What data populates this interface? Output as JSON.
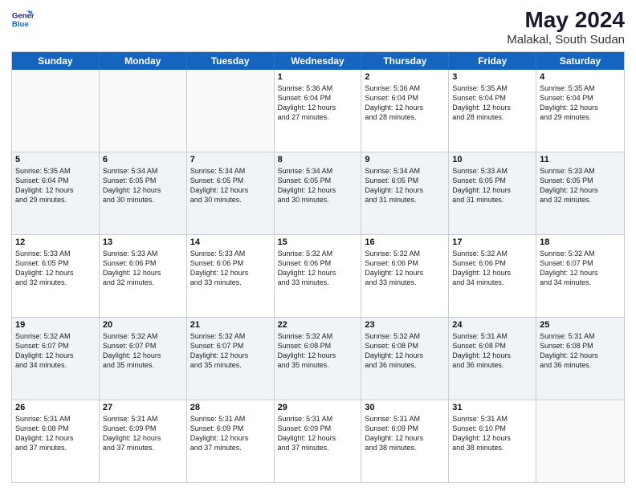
{
  "logo": {
    "line1": "General",
    "line2": "Blue"
  },
  "title": "May 2024",
  "subtitle": "Malakal, South Sudan",
  "days": [
    "Sunday",
    "Monday",
    "Tuesday",
    "Wednesday",
    "Thursday",
    "Friday",
    "Saturday"
  ],
  "weeks": [
    [
      {
        "day": "",
        "text": ""
      },
      {
        "day": "",
        "text": ""
      },
      {
        "day": "",
        "text": ""
      },
      {
        "day": "1",
        "text": "Sunrise: 5:36 AM\nSunset: 6:04 PM\nDaylight: 12 hours\nand 27 minutes."
      },
      {
        "day": "2",
        "text": "Sunrise: 5:36 AM\nSunset: 6:04 PM\nDaylight: 12 hours\nand 28 minutes."
      },
      {
        "day": "3",
        "text": "Sunrise: 5:35 AM\nSunset: 6:04 PM\nDaylight: 12 hours\nand 28 minutes."
      },
      {
        "day": "4",
        "text": "Sunrise: 5:35 AM\nSunset: 6:04 PM\nDaylight: 12 hours\nand 29 minutes."
      }
    ],
    [
      {
        "day": "5",
        "text": "Sunrise: 5:35 AM\nSunset: 6:04 PM\nDaylight: 12 hours\nand 29 minutes."
      },
      {
        "day": "6",
        "text": "Sunrise: 5:34 AM\nSunset: 6:05 PM\nDaylight: 12 hours\nand 30 minutes."
      },
      {
        "day": "7",
        "text": "Sunrise: 5:34 AM\nSunset: 6:05 PM\nDaylight: 12 hours\nand 30 minutes."
      },
      {
        "day": "8",
        "text": "Sunrise: 5:34 AM\nSunset: 6:05 PM\nDaylight: 12 hours\nand 30 minutes."
      },
      {
        "day": "9",
        "text": "Sunrise: 5:34 AM\nSunset: 6:05 PM\nDaylight: 12 hours\nand 31 minutes."
      },
      {
        "day": "10",
        "text": "Sunrise: 5:33 AM\nSunset: 6:05 PM\nDaylight: 12 hours\nand 31 minutes."
      },
      {
        "day": "11",
        "text": "Sunrise: 5:33 AM\nSunset: 6:05 PM\nDaylight: 12 hours\nand 32 minutes."
      }
    ],
    [
      {
        "day": "12",
        "text": "Sunrise: 5:33 AM\nSunset: 6:05 PM\nDaylight: 12 hours\nand 32 minutes."
      },
      {
        "day": "13",
        "text": "Sunrise: 5:33 AM\nSunset: 6:06 PM\nDaylight: 12 hours\nand 32 minutes."
      },
      {
        "day": "14",
        "text": "Sunrise: 5:33 AM\nSunset: 6:06 PM\nDaylight: 12 hours\nand 33 minutes."
      },
      {
        "day": "15",
        "text": "Sunrise: 5:32 AM\nSunset: 6:06 PM\nDaylight: 12 hours\nand 33 minutes."
      },
      {
        "day": "16",
        "text": "Sunrise: 5:32 AM\nSunset: 6:06 PM\nDaylight: 12 hours\nand 33 minutes."
      },
      {
        "day": "17",
        "text": "Sunrise: 5:32 AM\nSunset: 6:06 PM\nDaylight: 12 hours\nand 34 minutes."
      },
      {
        "day": "18",
        "text": "Sunrise: 5:32 AM\nSunset: 6:07 PM\nDaylight: 12 hours\nand 34 minutes."
      }
    ],
    [
      {
        "day": "19",
        "text": "Sunrise: 5:32 AM\nSunset: 6:07 PM\nDaylight: 12 hours\nand 34 minutes."
      },
      {
        "day": "20",
        "text": "Sunrise: 5:32 AM\nSunset: 6:07 PM\nDaylight: 12 hours\nand 35 minutes."
      },
      {
        "day": "21",
        "text": "Sunrise: 5:32 AM\nSunset: 6:07 PM\nDaylight: 12 hours\nand 35 minutes."
      },
      {
        "day": "22",
        "text": "Sunrise: 5:32 AM\nSunset: 6:08 PM\nDaylight: 12 hours\nand 35 minutes."
      },
      {
        "day": "23",
        "text": "Sunrise: 5:32 AM\nSunset: 6:08 PM\nDaylight: 12 hours\nand 36 minutes."
      },
      {
        "day": "24",
        "text": "Sunrise: 5:31 AM\nSunset: 6:08 PM\nDaylight: 12 hours\nand 36 minutes."
      },
      {
        "day": "25",
        "text": "Sunrise: 5:31 AM\nSunset: 6:08 PM\nDaylight: 12 hours\nand 36 minutes."
      }
    ],
    [
      {
        "day": "26",
        "text": "Sunrise: 5:31 AM\nSunset: 6:08 PM\nDaylight: 12 hours\nand 37 minutes."
      },
      {
        "day": "27",
        "text": "Sunrise: 5:31 AM\nSunset: 6:09 PM\nDaylight: 12 hours\nand 37 minutes."
      },
      {
        "day": "28",
        "text": "Sunrise: 5:31 AM\nSunset: 6:09 PM\nDaylight: 12 hours\nand 37 minutes."
      },
      {
        "day": "29",
        "text": "Sunrise: 5:31 AM\nSunset: 6:09 PM\nDaylight: 12 hours\nand 37 minutes."
      },
      {
        "day": "30",
        "text": "Sunrise: 5:31 AM\nSunset: 6:09 PM\nDaylight: 12 hours\nand 38 minutes."
      },
      {
        "day": "31",
        "text": "Sunrise: 5:31 AM\nSunset: 6:10 PM\nDaylight: 12 hours\nand 38 minutes."
      },
      {
        "day": "",
        "text": ""
      }
    ]
  ]
}
